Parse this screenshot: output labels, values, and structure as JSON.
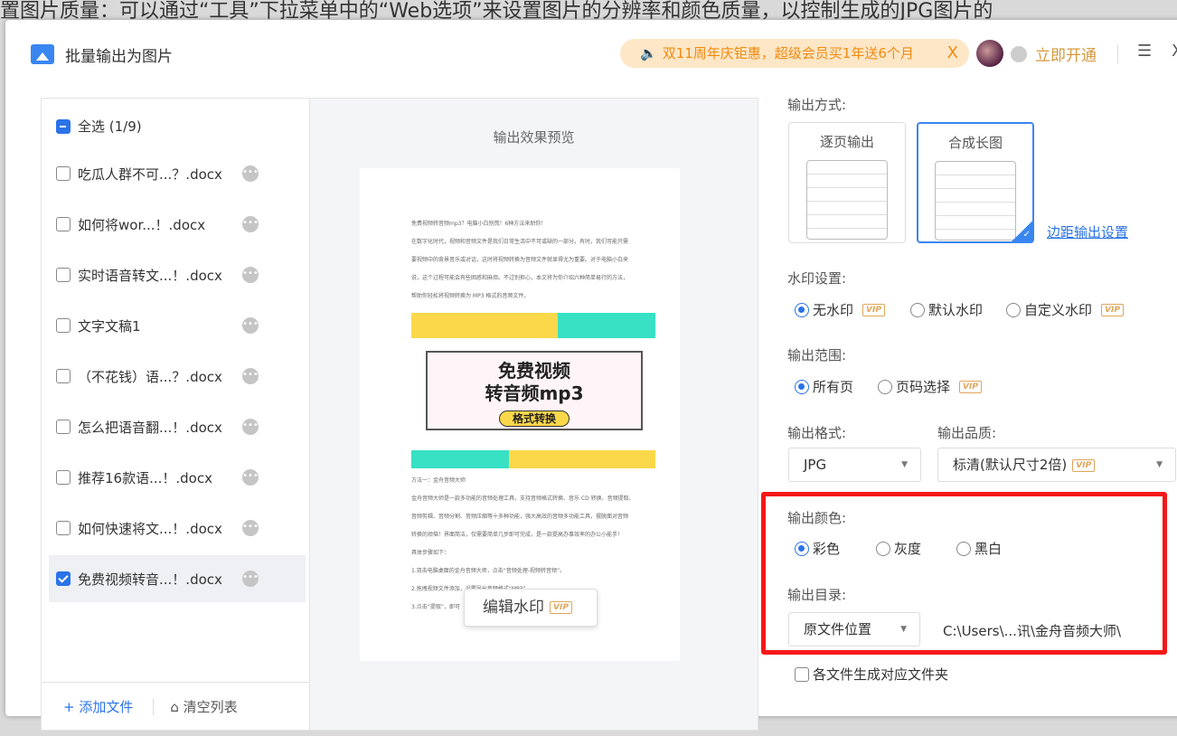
{
  "background_text": "置图片质量：可以通过“工具”下拉菜单中的“Web选项”来设置图片的分辨率和颜色质量，以控制生成的JPG图片的",
  "window": {
    "title": "批量输出为图片",
    "promo": "双11周年庆钜惠，超级会员买1年送6个月",
    "promo_close": "X",
    "open_vip": "立即开通",
    "menu": "☰",
    "close": "X"
  },
  "file_list": {
    "select_all": "全选 (1/9)",
    "items": [
      {
        "name": "吃瓜人群不可...？.docx",
        "checked": false
      },
      {
        "name": "如何将wor...！.docx",
        "checked": false
      },
      {
        "name": "实时语音转文...！.docx",
        "checked": false
      },
      {
        "name": "文字文稿1",
        "checked": false
      },
      {
        "name": "（不花钱）语...？.docx",
        "checked": false
      },
      {
        "name": "怎么把语音翻...！.docx",
        "checked": false
      },
      {
        "name": "推荐16款语...！.docx",
        "checked": false
      },
      {
        "name": "如何快速将文...！.docx",
        "checked": false
      },
      {
        "name": "免费视频转音...！.docx",
        "checked": true
      }
    ],
    "more": "•••",
    "add_file": "+ 添加文件",
    "clear_list": "清空列表"
  },
  "preview": {
    "title": "输出效果预览",
    "doc_lines_top": [
      "免费视频转音频mp3？电脑小白别慌！6种方法来助你！",
      "在数字化时代，视频和音频文件是我们日常生活中不可或缺的一部分。有时，我们可能只需",
      "要视频中的背景音乐或对话，这时将视频转换为音频文件就显得尤为重要。对于电脑小白来",
      "说，这个过程可能会有些困惑和麻烦。不过别担心，本文将为你介绍六种简单易行的方法，",
      "帮助你轻松将视频转换为 MP3 格式的音频文件。"
    ],
    "banner_line1": "免费视频",
    "banner_line2": "转音频mp3",
    "banner_tag": "格式转换",
    "doc_lines_bottom": [
      "方法一：金舟音频大师",
      "金舟音频大师是一款多功能的音频处理工具，支持音频格式转换、音乐 CD 转换、音频提取、",
      "音频剪辑、音频分割、音频压缩等十多种功能，强大高效的音频多功能工具，摆脱面对音频",
      "转换的烦恼！界面简洁，仅需要简单几步即可完成，是一款提高办事效率的办公小能手！",
      "具体步骤如下：",
      "1.双击电脑桌面的金舟音频大师，点击“音频处理-视频转音频”。",
      "2.拖拽视频文件添加，设置导出音频格式“MP3”。",
      "3.点击“提取”，即可"
    ],
    "edit_watermark": "编辑水印",
    "vip": "VIP"
  },
  "settings": {
    "output_mode_label": "输出方式:",
    "mode_page": "逐页输出",
    "mode_long": "合成长图",
    "margin_link": "边距输出设置",
    "watermark_label": "水印设置:",
    "wm_none": "无水印",
    "wm_default": "默认水印",
    "wm_custom": "自定义水印",
    "range_label": "输出范围:",
    "range_all": "所有页",
    "range_pick": "页码选择",
    "format_label": "输出格式:",
    "format_value": "JPG",
    "quality_label": "输出品质:",
    "quality_value": "标清(默认尺寸2倍)",
    "color_label": "输出颜色:",
    "color_color": "彩色",
    "color_gray": "灰度",
    "color_bw": "黑白",
    "dir_label": "输出目录:",
    "dir_value": "原文件位置",
    "dir_path": "C:\\Users\\...讯\\金舟音频大师\\",
    "per_folder": "各文件生成对应文件夹",
    "vip": "VIP"
  },
  "colors": {
    "accent": "#2a73e8",
    "highlight": "#f51818",
    "promo_bg": "#fde7c7",
    "vip": "#e0a55a"
  }
}
